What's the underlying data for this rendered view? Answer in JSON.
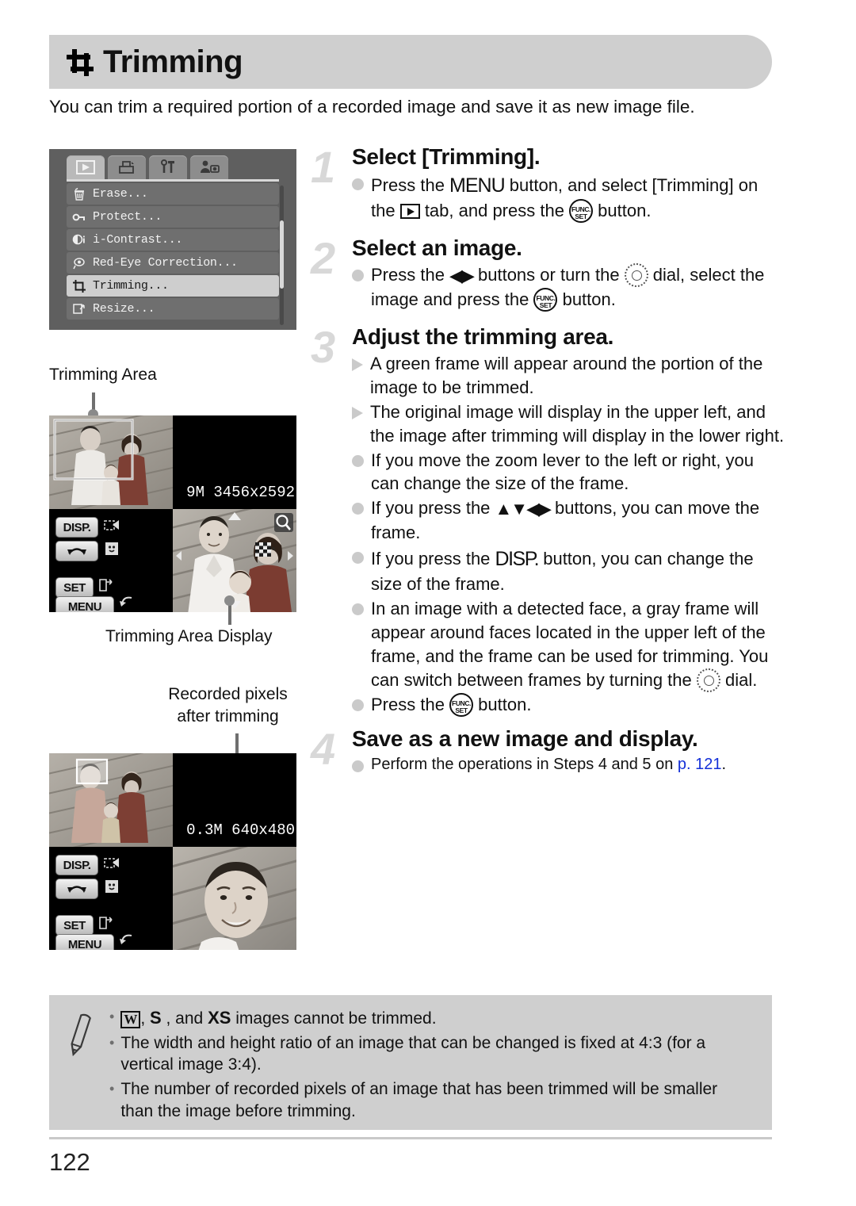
{
  "page": {
    "title": "Trimming",
    "title_icon": "crop-icon",
    "intro": "You can trim a required portion of a recorded image and save it as new image file.",
    "page_number": "122"
  },
  "menu_screen": {
    "tabs": [
      {
        "name": "playback-tab",
        "icon": "play-icon",
        "active": true
      },
      {
        "name": "print-tab",
        "icon": "printer-icon",
        "active": false
      },
      {
        "name": "settings-tab",
        "icon": "tools-icon",
        "active": false
      },
      {
        "name": "my-camera-tab",
        "icon": "person-camera-icon",
        "active": false
      }
    ],
    "items": [
      {
        "label": "Erase...",
        "icon": "trash-icon",
        "selected": false
      },
      {
        "label": "Protect...",
        "icon": "key-icon",
        "selected": false
      },
      {
        "label": "i-Contrast...",
        "icon": "contrast-icon",
        "selected": false
      },
      {
        "label": "Red-Eye Correction...",
        "icon": "eye-icon",
        "selected": false
      },
      {
        "label": "Trimming...",
        "icon": "crop-icon",
        "selected": true
      },
      {
        "label": "Resize...",
        "icon": "resize-icon",
        "selected": false
      }
    ]
  },
  "captions": {
    "trimming_area": "Trimming Area",
    "trimming_area_display": "Trimming Area Display",
    "recorded_pixels_line1": "Recorded pixels",
    "recorded_pixels_line2": "after trimming"
  },
  "lcd_top": {
    "info": "9M 3456x2592",
    "disp_label": "DISP.",
    "set_label": "SET",
    "menu_label": "MENU"
  },
  "lcd_bottom": {
    "info": "0.3M 640x480",
    "disp_label": "DISP.",
    "set_label": "SET",
    "menu_label": "MENU"
  },
  "steps": [
    {
      "number": "1",
      "title": "Select [Trimming].",
      "bullets": [
        {
          "type": "dot",
          "parts": [
            {
              "t": "text",
              "v": "Press the "
            },
            {
              "t": "menu"
            },
            {
              "t": "text",
              "v": " button, and select [Trimming] on the "
            },
            {
              "t": "play"
            },
            {
              "t": "text",
              "v": " tab, and press the "
            },
            {
              "t": "func"
            },
            {
              "t": "text",
              "v": " button."
            }
          ]
        }
      ]
    },
    {
      "number": "2",
      "title": "Select an image.",
      "bullets": [
        {
          "type": "dot",
          "parts": [
            {
              "t": "text",
              "v": "Press the "
            },
            {
              "t": "lr"
            },
            {
              "t": "text",
              "v": " buttons or turn the "
            },
            {
              "t": "dial"
            },
            {
              "t": "text",
              "v": " dial, select the image and press the "
            },
            {
              "t": "func"
            },
            {
              "t": "text",
              "v": " button."
            }
          ]
        }
      ]
    },
    {
      "number": "3",
      "title": "Adjust the trimming area.",
      "bullets": [
        {
          "type": "tri",
          "parts": [
            {
              "t": "text",
              "v": "A green frame will appear around the portion of the image to be trimmed."
            }
          ]
        },
        {
          "type": "tri",
          "parts": [
            {
              "t": "text",
              "v": "The original image will display in the upper left, and the image after trimming will display in the lower right."
            }
          ]
        },
        {
          "type": "dot",
          "parts": [
            {
              "t": "text",
              "v": "If you move the zoom lever to the left or right, you can change the size of the frame."
            }
          ]
        },
        {
          "type": "dot",
          "parts": [
            {
              "t": "text",
              "v": "If you press the "
            },
            {
              "t": "udlr"
            },
            {
              "t": "text",
              "v": " buttons, you can move the frame."
            }
          ]
        },
        {
          "type": "dot",
          "parts": [
            {
              "t": "text",
              "v": "If you press the "
            },
            {
              "t": "disp"
            },
            {
              "t": "text",
              "v": " button, you can change the size of the frame."
            }
          ]
        },
        {
          "type": "dot",
          "parts": [
            {
              "t": "text",
              "v": "In an image with a detected face, a gray frame will appear around faces located in the upper left of the frame, and the frame can be used for trimming. You can switch between frames by turning the "
            },
            {
              "t": "dial"
            },
            {
              "t": "text",
              "v": " dial."
            }
          ]
        },
        {
          "type": "dot",
          "parts": [
            {
              "t": "text",
              "v": "Press the "
            },
            {
              "t": "func"
            },
            {
              "t": "text",
              "v": " button."
            }
          ]
        }
      ]
    },
    {
      "number": "4",
      "title": "Save as a new image and display.",
      "bullets": [
        {
          "type": "dot",
          "small": true,
          "parts": [
            {
              "t": "text",
              "v": "Perform the operations in Steps 4 and 5 on "
            },
            {
              "t": "pgref",
              "v": "p. 121"
            },
            {
              "t": "text",
              "v": "."
            }
          ]
        }
      ]
    }
  ],
  "note": {
    "icon": "pencil-icon",
    "bullets": [
      {
        "parts": [
          {
            "t": "chipbox",
            "v": "W"
          },
          {
            "t": "text",
            "v": ", "
          },
          {
            "t": "chipb",
            "v": "S"
          },
          {
            "t": "text",
            "v": " , and "
          },
          {
            "t": "chipb",
            "v": "XS"
          },
          {
            "t": "text",
            "v": " images cannot be trimmed."
          }
        ]
      },
      {
        "parts": [
          {
            "t": "text",
            "v": "The width and height ratio of an image that can be changed is fixed at 4:3 (for a vertical image 3:4)."
          }
        ]
      },
      {
        "parts": [
          {
            "t": "text",
            "v": "The number of recorded pixels of an image that has been trimmed will be smaller than the image before trimming."
          }
        ]
      }
    ]
  },
  "colors": {
    "header_bg": "#cfcfcf",
    "note_bg": "#cfcfcf",
    "step_number": "#d8d8d8",
    "bullet_dot": "#cacaca",
    "link": "#1430d8"
  }
}
